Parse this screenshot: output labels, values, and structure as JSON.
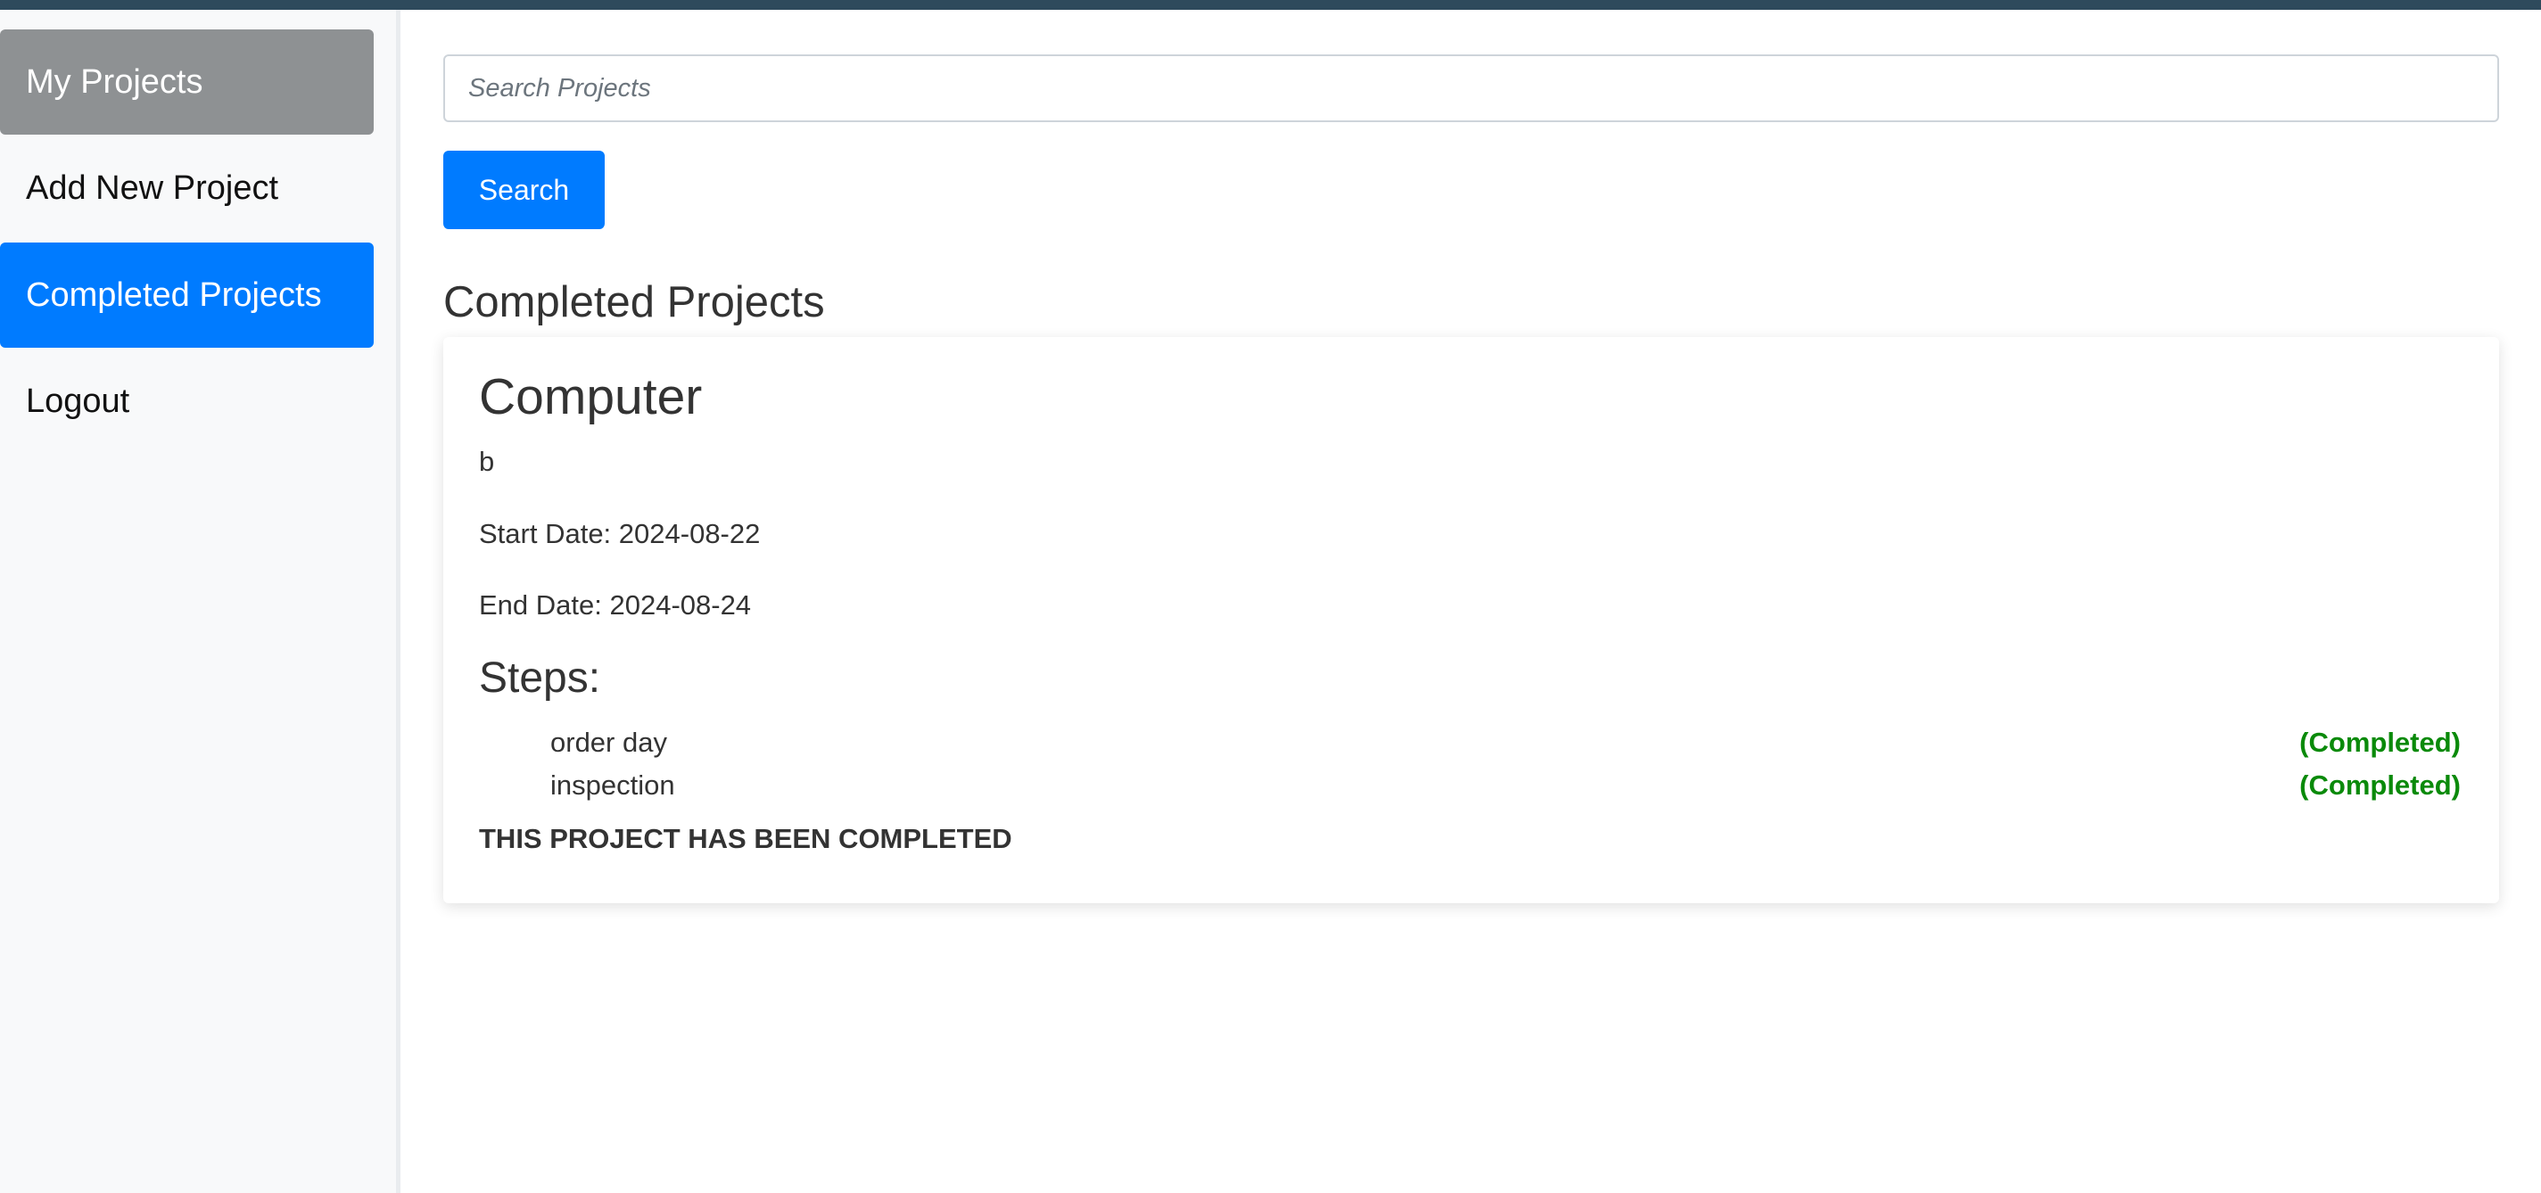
{
  "sidebar": {
    "items": [
      {
        "label": "My Projects"
      },
      {
        "label": "Add New Project"
      },
      {
        "label": "Completed Projects"
      },
      {
        "label": "Logout"
      }
    ]
  },
  "search": {
    "placeholder": "Search Projects",
    "button_label": "Search"
  },
  "main": {
    "section_title": "Completed Projects"
  },
  "project": {
    "name": "Computer",
    "description": "b",
    "start_date": "Start Date: 2024-08-22",
    "end_date": "End Date: 2024-08-24",
    "steps_heading": "Steps:",
    "steps": [
      {
        "name": "order day",
        "status": "(Completed)"
      },
      {
        "name": "inspection",
        "status": "(Completed)"
      }
    ],
    "completed_message": "THIS PROJECT HAS BEEN COMPLETED"
  },
  "colors": {
    "accent": "#007bff",
    "active_gray": "#8e9193",
    "topbar": "#2e4a5c",
    "completed_green": "#0a8a0a"
  }
}
